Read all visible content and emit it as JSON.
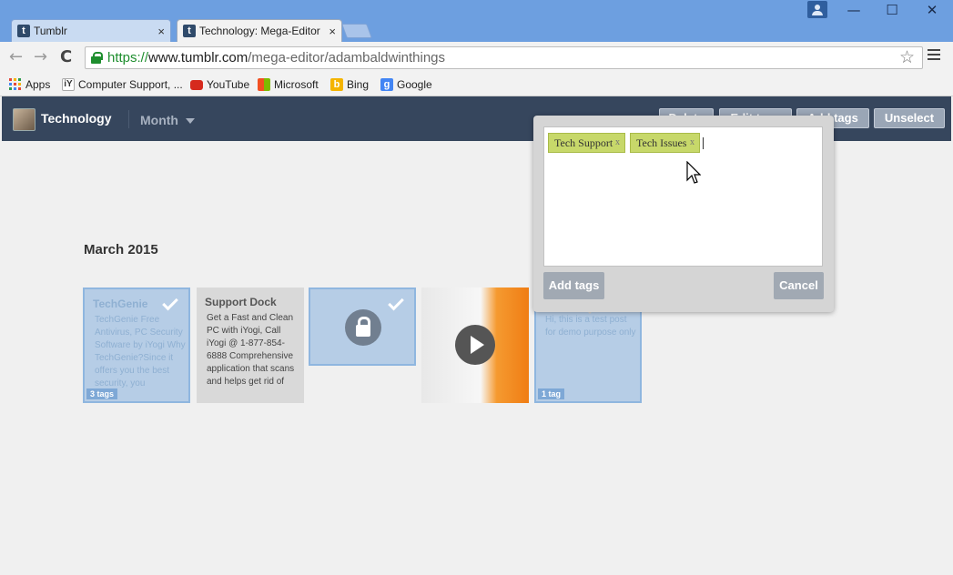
{
  "browser": {
    "tabs": [
      {
        "title": "Tumblr",
        "favicon": "t",
        "close": "×"
      },
      {
        "title": "Technology: Mega-Editor",
        "favicon": "t",
        "close": "×"
      }
    ],
    "window_controls": {
      "minimize": "—",
      "maximize": "☐",
      "close": "✕"
    },
    "address": {
      "protocol": "https://",
      "host": "www.tumblr.com",
      "path": "/mega-editor/adambaldwinthings"
    },
    "nav": {
      "back": "←",
      "forward": "→",
      "reload": "C"
    },
    "star": "☆",
    "bookmarks": [
      {
        "label": "Apps",
        "icon": "apps-grid-icon"
      },
      {
        "label": "Computer Support, ...",
        "icon": "iyogi-icon"
      },
      {
        "label": "YouTube",
        "icon": "youtube-icon"
      },
      {
        "label": "Microsoft",
        "icon": "microsoft-icon"
      },
      {
        "label": "Bing",
        "icon": "bing-icon"
      },
      {
        "label": "Google",
        "icon": "google-icon"
      }
    ]
  },
  "editor": {
    "blog_name": "Technology",
    "period_select": "Month",
    "actions": {
      "delete": "Delete",
      "edit_tags": "Edit tags",
      "add_tags": "Add tags",
      "unselect": "Unselect"
    },
    "month_title": "March 2015",
    "posts": [
      {
        "title": "TechGenie",
        "body": "TechGenie Free Antivirus, PC Security Software by iYogi        Why TechGenie?Since it offers you the best security, you",
        "tag_count": "3 tags",
        "selected": true
      },
      {
        "title": "Support Dock",
        "body": "Get a Fast and Clean PC with iYogi, Call iYogi @  1-877-854-6888 Comprehensive application that scans and helps get rid of",
        "selected": false
      },
      {
        "type": "photo",
        "selected": true
      },
      {
        "type": "video",
        "selected": false
      },
      {
        "body": "Hi, this is a test post for demo purpose only",
        "tag_count": "1 tag",
        "selected": true
      }
    ]
  },
  "popover": {
    "tags": [
      {
        "label": "Tech Support",
        "remove": "x"
      },
      {
        "label": "Tech Issues",
        "remove": "x"
      }
    ],
    "add_button": "Add tags",
    "cancel_button": "Cancel"
  },
  "colors": {
    "header_bg": "#36465d",
    "selected_tile": "#b6cde6",
    "tag_chip": "#c7d86a",
    "titlebar": "#6d9fe0"
  }
}
